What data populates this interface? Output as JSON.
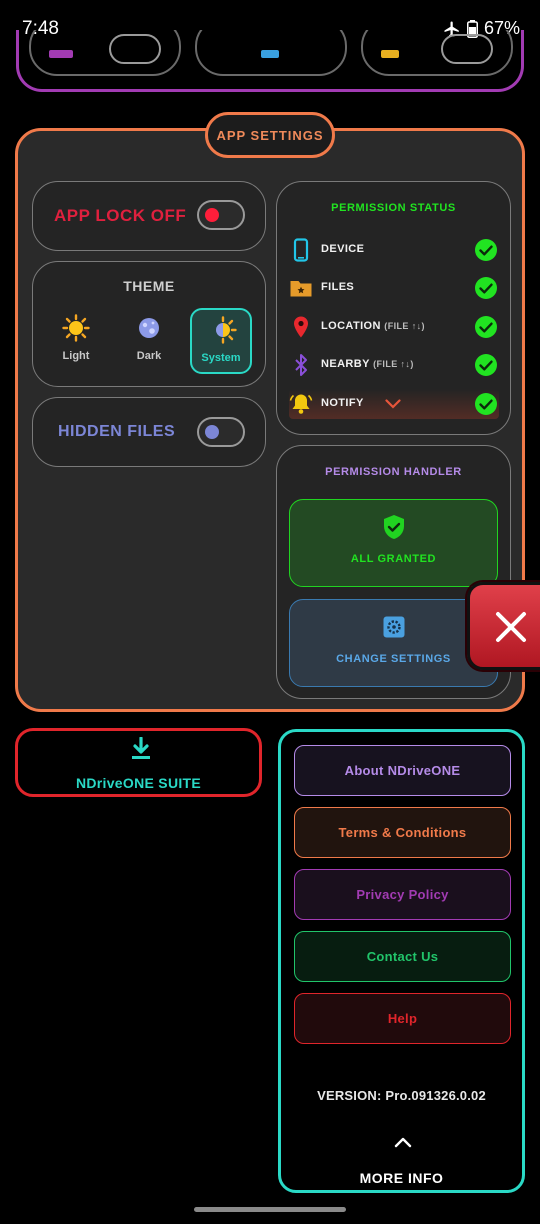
{
  "status_bar": {
    "time": "7:48",
    "battery": "67%"
  },
  "app_settings": {
    "title": "APP SETTINGS",
    "app_lock": {
      "label": "APP LOCK OFF",
      "state": "off"
    },
    "theme": {
      "title": "THEME",
      "options": [
        {
          "label": "Light",
          "icon": "sun-icon"
        },
        {
          "label": "Dark",
          "icon": "moon-icon"
        },
        {
          "label": "System",
          "icon": "half-sun-icon",
          "selected": true
        }
      ]
    },
    "hidden_files": {
      "label": "HIDDEN FILES",
      "state": "off"
    },
    "permission_status": {
      "title": "PERMISSION STATUS",
      "items": [
        {
          "name": "DEVICE",
          "sub": "",
          "icon": "phone-icon"
        },
        {
          "name": "FILES",
          "sub": "",
          "icon": "folder-icon"
        },
        {
          "name": "LOCATION",
          "sub": "(FILE ↑↓)",
          "icon": "location-pin-icon"
        },
        {
          "name": "NEARBY",
          "sub": "(FILE ↑↓)",
          "icon": "bluetooth-icon"
        },
        {
          "name": "NOTIFY",
          "sub": "",
          "icon": "bell-icon"
        }
      ]
    },
    "permission_handler": {
      "title": "PERMISSION HANDLER",
      "all_granted": "ALL GRANTED",
      "change_settings": "CHANGE SETTINGS"
    }
  },
  "suite": {
    "label": "NDriveONE SUITE"
  },
  "info_panel": {
    "buttons": [
      {
        "label": "About NDriveONE",
        "color": "#b58be8"
      },
      {
        "label": "Terms & Conditions",
        "color": "#f07a4a"
      },
      {
        "label": "Privacy Policy",
        "color": "#a23bb3"
      },
      {
        "label": "Contact Us",
        "color": "#21c46a"
      },
      {
        "label": "Help",
        "color": "#e0252b"
      }
    ],
    "version": "VERSION: Pro.091326.0.02",
    "more_info": "MORE INFO"
  },
  "colors": {
    "accent_orange": "#f07a4a",
    "accent_teal": "#2ad9c6",
    "accent_green": "#21e321",
    "accent_red": "#e0252b",
    "accent_purple": "#a23bb3"
  }
}
